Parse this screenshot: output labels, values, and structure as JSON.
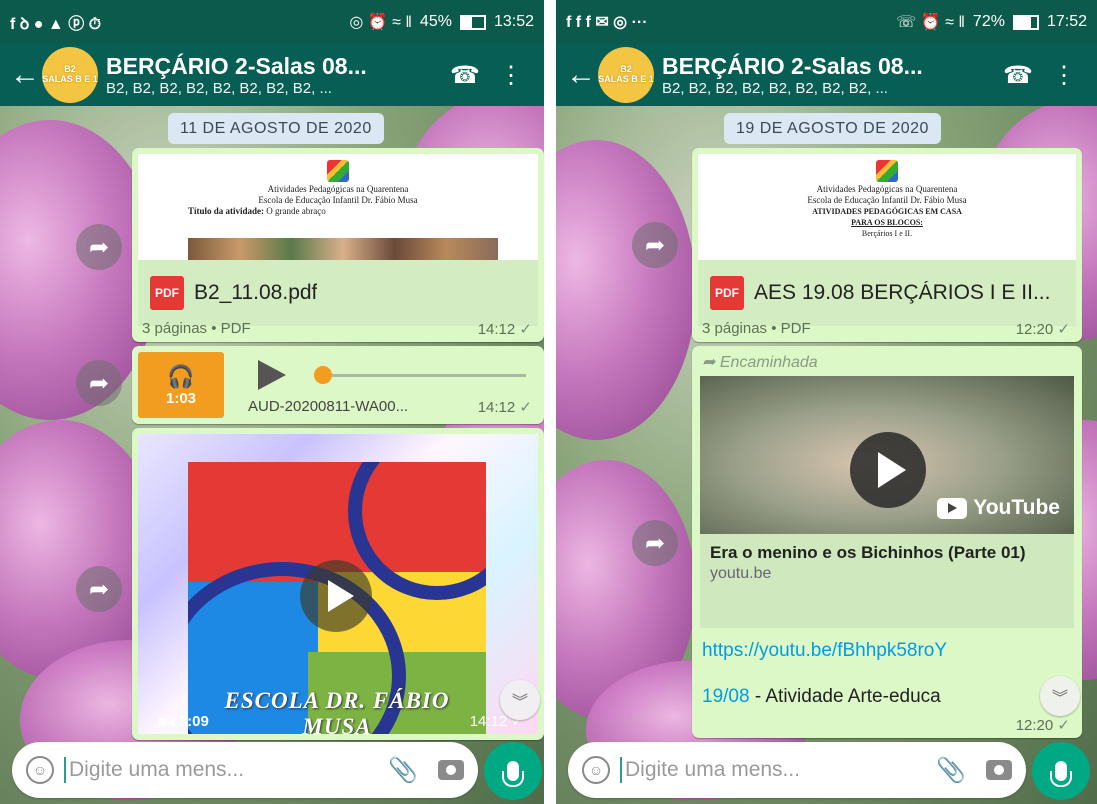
{
  "left": {
    "status": {
      "icons": "f ꝺ ● ▲ ⓟ ⏱",
      "right_icons": "◎ ⏰ ≈ ‖",
      "battery": "45%",
      "time": "13:52"
    },
    "chat": {
      "avatar_line1": "B2",
      "avatar_line2": "SALAS B E 1",
      "title": "BERÇÁRIO 2-Salas 08...",
      "subtitle": "B2, B2, B2, B2, B2, B2, B2, B2, ..."
    },
    "date_chip": "11 DE AGOSTO DE 2020",
    "doc_message": {
      "preview_lines": [
        "Atividades Pedagógicas na Quarentena",
        "Escola de Educação Infantil Dr. Fábio Musa"
      ],
      "preview_title_label": "Título da atividade:",
      "preview_title_value": "O grande abraço",
      "file_name": "B2_11.08.pdf",
      "meta": "3 páginas • PDF",
      "time": "14:12"
    },
    "audio_message": {
      "duration": "1:03",
      "file_name": "AUD-20200811-WA00...",
      "time": "14:12",
      "progress": 0.0
    },
    "video_message": {
      "caption_art": "ESCOLA DR. FÁBIO MUSA",
      "duration": "3:09",
      "time": "14:12"
    },
    "input": {
      "placeholder": "Digite uma mens..."
    }
  },
  "right": {
    "status": {
      "icons": "f f f ✉ ◎ ···",
      "right_icons": "☏ ⏰ ≈ ‖",
      "battery": "72%",
      "time": "17:52"
    },
    "chat": {
      "avatar_line1": "B2",
      "avatar_line2": "SALAS B E 1",
      "title": "BERÇÁRIO 2-Salas 08...",
      "subtitle": "B2, B2, B2, B2, B2, B2, B2, B2, ..."
    },
    "date_chip": "19 DE AGOSTO DE 2020",
    "doc_message": {
      "preview_lines": [
        "Atividades Pedagógicas na Quarentena",
        "Escola de Educação Infantil Dr. Fábio Musa",
        "ATIVIDADES PEDAGÓGICAS EM CASA",
        "PARA OS BLOCOS:",
        "Berçários I e II."
      ],
      "file_name": "AES 19.08 BERÇÁRIOS I E II...",
      "meta": "3 páginas • PDF",
      "time": "12:20"
    },
    "link_message": {
      "forwarded": "Encaminhada",
      "youtube_brand": "YouTube",
      "title": "Era o menino e os Bichinhos (Parte 01)",
      "domain": "youtu.be",
      "url": "https://youtu.be/fBhhpk58roY",
      "text_date": "19/08",
      "text_rest": " - Atividade Arte-educa",
      "time": "12:20"
    },
    "input": {
      "placeholder": "Digite uma mens..."
    }
  },
  "colors": {
    "header": "#075e54",
    "bubble": "#dcf8c6",
    "accent_orange": "#f29d1f",
    "mic": "#00a884",
    "link": "#039be5"
  }
}
